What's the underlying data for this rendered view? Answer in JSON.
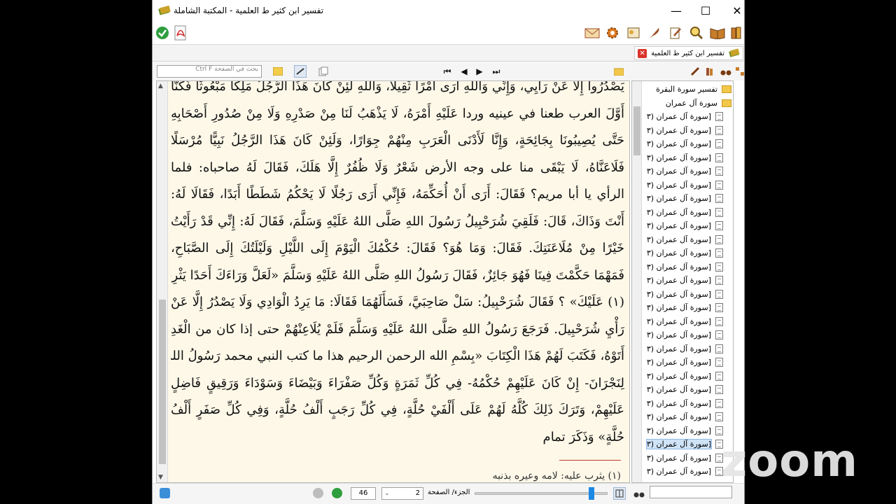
{
  "window": {
    "title": "تفسير ابن كثير ط العلمية - المكتبة الشاملة",
    "min_glyph": "—",
    "max_glyph": "☐",
    "close_glyph": "✕"
  },
  "toolbar": {
    "left_icons": [
      "check-circle-icon",
      "pdf-icon"
    ],
    "right_icons": [
      "letter-icon",
      "gear-icon",
      "settings-icon",
      "quill-icon",
      "edit-icon",
      "search-icon",
      "open-book-icon",
      "books-icon"
    ]
  },
  "tab": {
    "label": "تفسير ابن كثير ط العلمية",
    "close_glyph": "✕"
  },
  "reader": {
    "search_placeholder": "بحث في الصفحة   Ctrl  F",
    "nav_first": "⏮",
    "nav_prev": "◀",
    "nav_next": "▶",
    "nav_last": "⏭",
    "lines": [
      "يَصْدُرُوا إِلَّا عَنْ رَأْيِي، وَإِنِّي وَاللهِ أَرَى أَمْرًا ثَقِيلًا، وَاللهِ لَئِنْ كَانَ هَذَا الرَّجُلُ مَلِكًا مَبْعُوثًا فَكُنَّا",
      "أَوَّلَ العرب طعنا في عينيه وردا عَلَيْهِ أَمْرَهُ، لَا يَذْهَبُ لَنَا مِنْ صَدْرِهِ وَلَا مِنْ صُدُورِ أَصْحَابِهِ",
      "حَتَّى يُصِيبُونَا بِجَائِحَةٍ، وَإِنَّا لَأَدْنَى الْعَرَبِ مِنْهُمْ جِوَارًا، وَلَئِنْ كَانَ هَذَا الرَّجُلُ نَبِيًّا مُرْسَلًا",
      "فَلَاعَنَّاهُ، لَا يَبْقَى منا على وجه الأرض شَعْرٌ وَلَا ظُفُرٌ إِلَّا هَلَكَ، فَقَالَ لَهُ صاحباه: فلما",
      "الرأي يا أبا مريم؟ فَقَالَ: أَرَى أَنْ أُحَكِّمَهُ، فَإِنِّي أَرَى رَجُلًا لَا يَحْكُمُ شَطَطًا أَبَدًا، فَقَالَا لَهُ:",
      "أَنْتَ وَذَاكَ، قَالَ: فَلَقِيَ شُرَحْبِيلُ رَسُولَ اللهِ صَلَّى اللهُ عَلَيْهِ وَسَلَّمَ، فَقَالَ لَهُ: إِنِّي قَدْ رَأَيْتُ",
      "خَيْرًا مِنْ مُلَاعَنَتِكَ. فَقَالَ: وَمَا هُوَ؟ فَقَالَ: حُكْمُكَ الْيَوْمَ إِلَى اللَّيْلِ وَلَيْلَتُكَ إِلَى الصَّبَاحِ،",
      "فَمَهْمَا حَكَّمْتَ فِينَا فَهُوَ جَائِزٌ، فَقَالَ رَسُولُ اللهِ صَلَّى اللهُ عَلَيْهِ وَسَلَّمَ «لَعَلَّ وَرَاءَكَ أَحَدًا يَثْرِبُ",
      "(١) عَلَيْكَ» ؟ فَقَالَ شُرَحْبِيلُ: سَلْ صَاحِبَيَّ، فَسَأَلَهُمَا فَقَالَا: مَا يَرِدُ الْوَادِي وَلَا يَصْدُرُ إِلَّا عَنْ",
      "رَأْيِ شُرَحْبِيلَ. فَرَجَعَ رَسُولُ اللهِ صَلَّى اللهُ عَلَيْهِ وَسَلَّمَ فَلَمْ يُلَاعِنْهُمْ حتى إذا كان من الْغَدِ",
      "أَتَوْهُ، فَكَتَبَ لَهُمْ هَذَا الْكِتَابَ «بِسْمِ الله الرحمن الرحيم هذا ما كتب النبي محمد رَسُولُ اللهِ",
      "لِنَجْرَانَ- إِنْ كَانَ عَلَيْهِمْ حُكْمُهُ- فِي كُلِّ ثَمَرَةٍ وَكُلِّ صَفْرَاءَ وَبَيْضَاءَ وَسَوْدَاءَ وَرَقِيقٍ فَاضِلٍ",
      "عَلَيْهِمْ، وَتَرَكَ ذَلِكَ كُلَّهُ لَهُمْ عَلَى أَلْفَيْ حُلَّةٍ، فِي كُلِّ رَجَبٍ أَلْفُ حُلَّةٍ، وَفِي كُلِّ صَفَرٍ أَلْفُ",
      "حُلَّةٍ» وَذَكَرَ تمام"
    ],
    "footnote": "(١) يثرب عليه: لامه وعيره بذنبه"
  },
  "status": {
    "page": "46",
    "part": "2",
    "part_page_label": "الجزء/ الصفحة",
    "zoom_level": 0.9
  },
  "tree": {
    "items": [
      {
        "label": "تفسير سورة البقرة",
        "level": 0,
        "icon": "folder-icon",
        "expander": "›"
      },
      {
        "label": "سورة آل عمران",
        "level": 0,
        "icon": "folder-icon",
        "expander": "⌄"
      },
      {
        "label": "[سورة آل عمران (٣",
        "level": 1,
        "icon": "page-icon"
      },
      {
        "label": "[سورة آل عمران (٣",
        "level": 1,
        "icon": "page-icon"
      },
      {
        "label": "[سورة آل عمران (٣",
        "level": 1,
        "icon": "page-icon"
      },
      {
        "label": "[سورة آل عمران (٣",
        "level": 1,
        "icon": "page-icon"
      },
      {
        "label": "[سورة آل عمران (٣",
        "level": 1,
        "icon": "page-icon"
      },
      {
        "label": "[سورة آل عمران (٣",
        "level": 1,
        "icon": "page-icon"
      },
      {
        "label": "[سورة آل عمران (٣",
        "level": 1,
        "icon": "page-icon"
      },
      {
        "label": "[سورة آل عمران (٣",
        "level": 1,
        "icon": "page-icon"
      },
      {
        "label": "[سورة آل عمران (٣",
        "level": 1,
        "icon": "page-icon"
      },
      {
        "label": "[سورة آل عمران (٣",
        "level": 1,
        "icon": "page-icon"
      },
      {
        "label": "[سورة آل عمران (٣",
        "level": 1,
        "icon": "page-icon"
      },
      {
        "label": "[سورة آل عمران (٣",
        "level": 1,
        "icon": "page-icon"
      },
      {
        "label": "[سورة آل عمران (٣",
        "level": 1,
        "icon": "page-icon"
      },
      {
        "label": "[سورة آل عمران (٣",
        "level": 1,
        "icon": "page-icon"
      },
      {
        "label": "[سورة آل عمران (٣",
        "level": 1,
        "icon": "page-icon"
      },
      {
        "label": "[سورة آل عمران (٣",
        "level": 1,
        "icon": "page-icon"
      },
      {
        "label": "[سورة آل عمران (٣",
        "level": 1,
        "icon": "page-icon"
      },
      {
        "label": "[سورة آل عمران (٣",
        "level": 1,
        "icon": "page-icon"
      },
      {
        "label": "[سورة آل عمران (٣",
        "level": 1,
        "icon": "page-icon"
      },
      {
        "label": "[سورة آل عمران (٣",
        "level": 1,
        "icon": "page-icon"
      },
      {
        "label": "[سورة آل عمران (٣",
        "level": 1,
        "icon": "page-icon"
      },
      {
        "label": "[سورة آل عمران (٣",
        "level": 1,
        "icon": "page-icon"
      },
      {
        "label": "[سورة آل عمران (٣",
        "level": 1,
        "icon": "page-icon"
      },
      {
        "label": "[سورة آل عمران (٣",
        "level": 1,
        "icon": "page-icon"
      },
      {
        "label": "[سورة آل عمران (٣",
        "level": 1,
        "icon": "page-icon",
        "selected": true
      },
      {
        "label": "[سورة آل عمران (٣",
        "level": 1,
        "icon": "page-icon"
      },
      {
        "label": "[سورة آل عمران (٣",
        "level": 1,
        "icon": "page-icon"
      }
    ]
  },
  "overlay": {
    "watermark": "zoom"
  },
  "colors": {
    "page_bg": "#fdf8e8",
    "accent": "#1e88e5",
    "footnote_rule": "#c0392b"
  }
}
